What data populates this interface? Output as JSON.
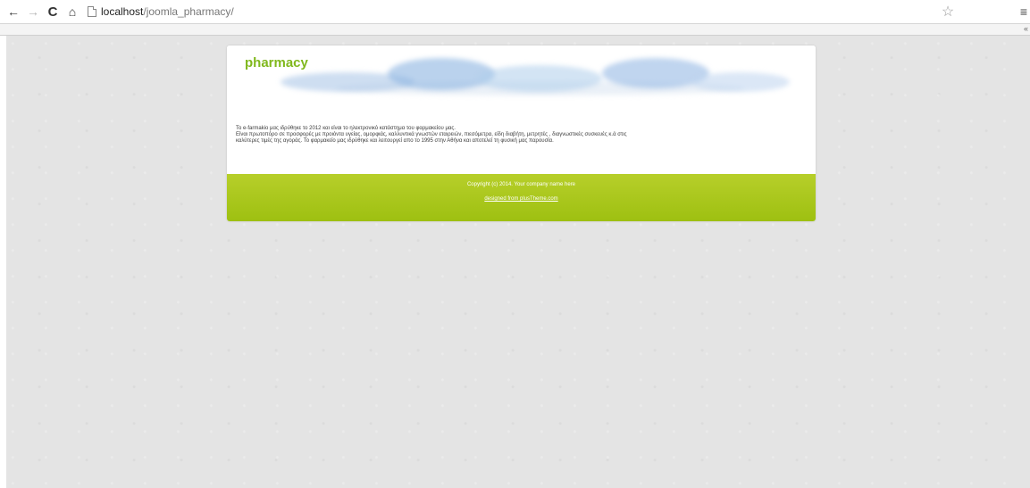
{
  "browser": {
    "url_host": "localhost",
    "url_path": "/joomla_pharmacy/",
    "back_glyph": "←",
    "forward_glyph": "→",
    "reload_glyph": "C",
    "home_glyph": "⌂",
    "star_glyph": "☆",
    "menu_glyph": "≡",
    "bookmark_glyph": "«"
  },
  "site": {
    "title": "pharmacy",
    "intro_lines": [
      "Το e-farmakio μας ιδρύθηκε το 2012 και είναι το ηλεκτρονικό κατάστημα του φαρμακείου μας.",
      "Είναι πρωτοπόρο σε προσφορές με προιόντα υγείας, ομορφιάς, καλλυντικά γνωστών εταιρειών, πιεσόμετρα, είδη διαβήτη, μετρητές , διαγνωστικές συσκευές κ.ά στις",
      "καλύτερες τιμές της αγοράς. Το φαρμακείο μας ιδρύθηκε και λειτουργεί απο το 1995 στην Αθήνα και αποτελεί τη φυσική μας παρουσία."
    ],
    "footer": {
      "copyright": "Copyright (c) 2014. Your company name here",
      "designed_link": "designed from plusTheme.com"
    },
    "colors": {
      "title_green": "#80b81d",
      "footer_green": "#a6c41a",
      "page_background": "#e4e4e4"
    }
  }
}
